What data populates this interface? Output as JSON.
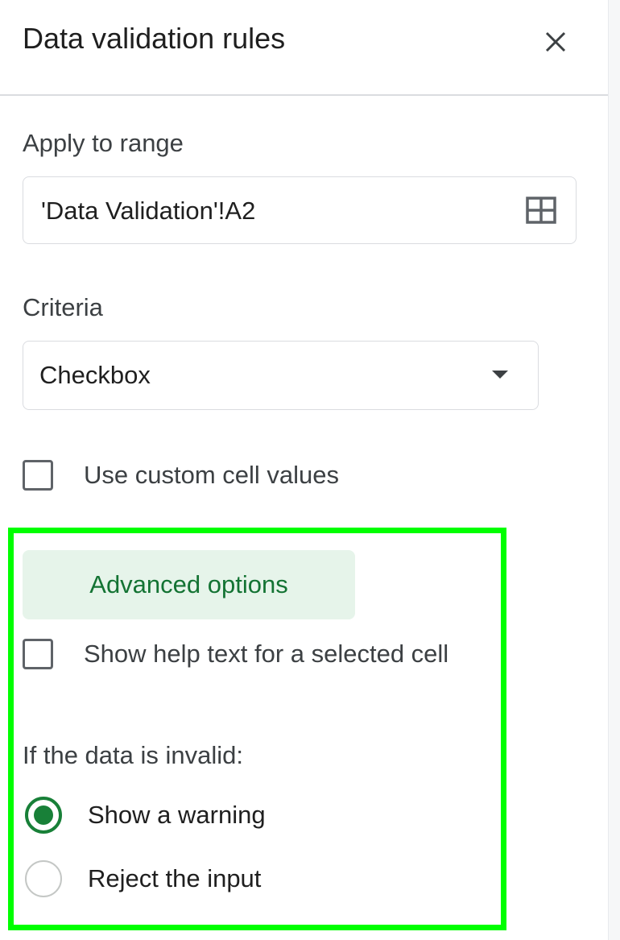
{
  "header": {
    "title": "Data validation rules",
    "close_icon": "close-icon"
  },
  "range": {
    "label": "Apply to range",
    "value": "'Data Validation'!A2",
    "icon": "grid-select-icon"
  },
  "criteria": {
    "label": "Criteria",
    "selected": "Checkbox",
    "icon": "dropdown-arrow-icon"
  },
  "custom_values": {
    "label": "Use custom cell values",
    "checked": false
  },
  "advanced": {
    "button_label": "Advanced options",
    "help_text": {
      "label": "Show help text for a selected cell",
      "checked": false
    },
    "invalid_heading": "If the data is invalid:",
    "options": [
      {
        "label": "Show a warning",
        "selected": true
      },
      {
        "label": "Reject the input",
        "selected": false
      }
    ]
  },
  "colors": {
    "accent_green": "#188038",
    "button_bg": "#e6f4ea",
    "highlight": "#00ff00"
  }
}
